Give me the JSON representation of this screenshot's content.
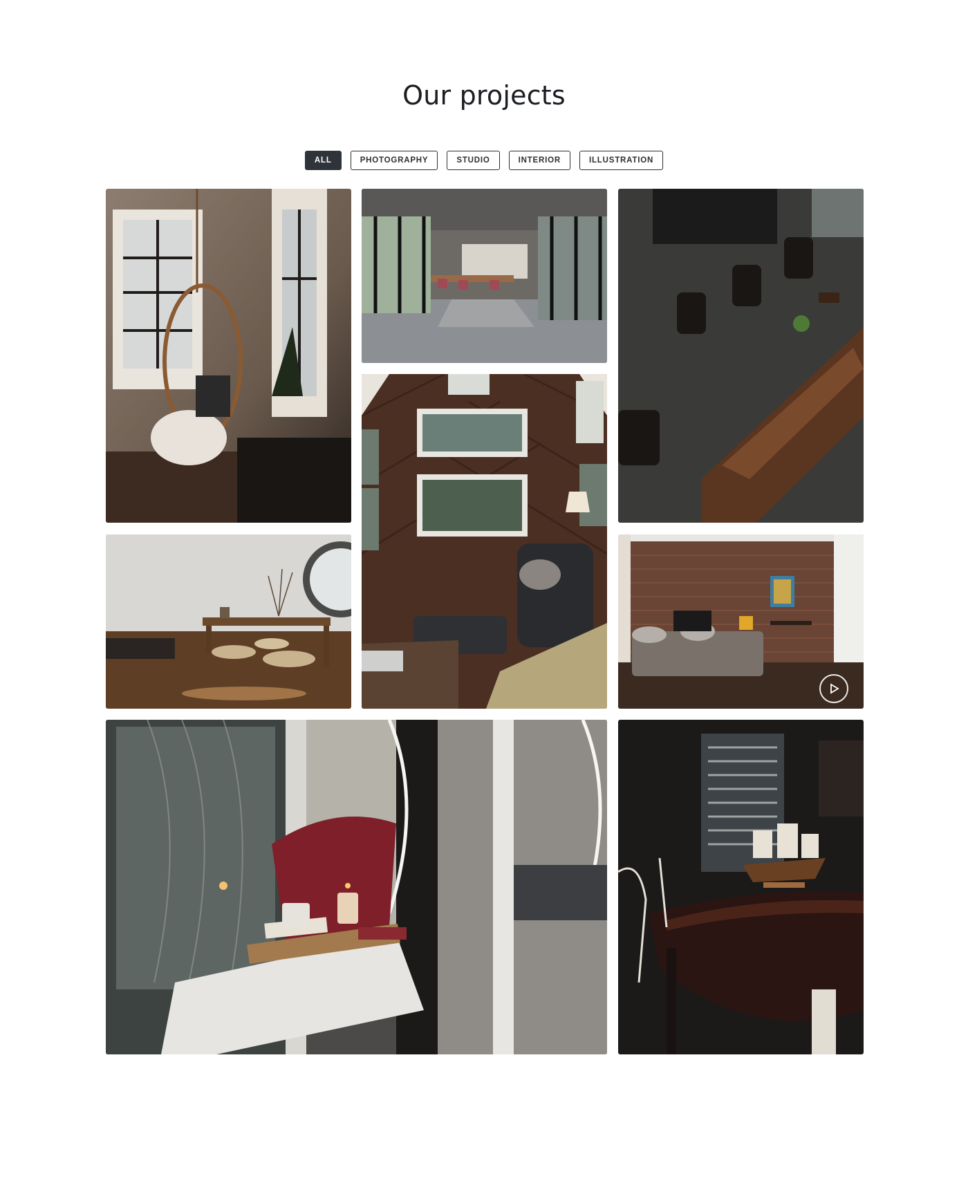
{
  "page": {
    "title": "Our projects"
  },
  "filters": [
    {
      "label": "ALL",
      "active": true
    },
    {
      "label": "PHOTOGRAPHY",
      "active": false
    },
    {
      "label": "STUDIO",
      "active": false
    },
    {
      "label": "INTERIOR",
      "active": false
    },
    {
      "label": "ILLUSTRATION",
      "active": false
    }
  ],
  "gallery": {
    "items": [
      {
        "subject": "hanging rattan chair by window"
      },
      {
        "subject": "office with glass walls and meeting table"
      },
      {
        "subject": "wooden dining table from above"
      },
      {
        "subject": "wood-paneled living room with armchair"
      },
      {
        "subject": "low table with floor cushions"
      },
      {
        "subject": "brick wall living room",
        "video": true
      },
      {
        "subject": "window seat with red pillow and candles"
      },
      {
        "subject": "dining table with model ship"
      }
    ]
  },
  "colors": {
    "active_filter_bg": "#2f343a",
    "filter_border": "#2a2e33",
    "text": "#1a1d21"
  }
}
